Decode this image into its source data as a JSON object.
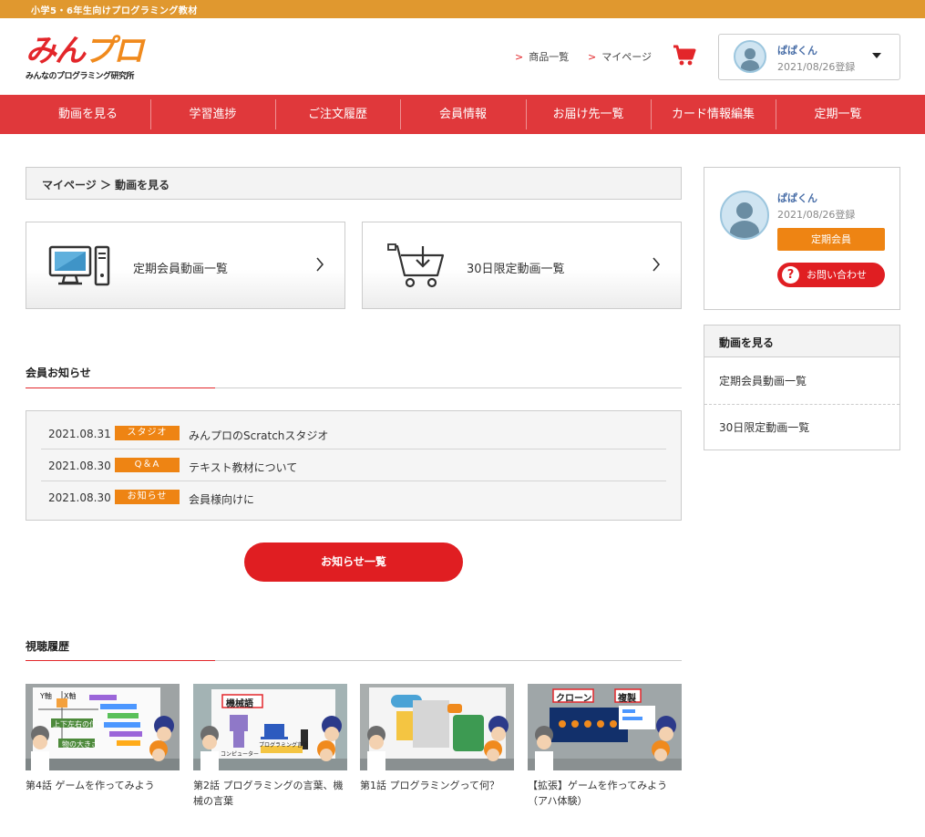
{
  "topbar": {
    "text": "小学5・6年生向けプログラミング教材"
  },
  "logo": {
    "main_a": "みん",
    "main_b": "プロ",
    "sub": "みんなのプログラミング研究所"
  },
  "header": {
    "links": [
      {
        "label": "商品一覧"
      },
      {
        "label": "マイページ"
      }
    ],
    "cart_icon": "cart-icon"
  },
  "user": {
    "name": "ぱぱくん",
    "registered": "2021/08/26登録",
    "plan": "定期会員",
    "contact": "お問い合わせ"
  },
  "nav": {
    "items": [
      "動画を見る",
      "学習進捗",
      "ご注文履歴",
      "会員情報",
      "お届け先一覧",
      "カード情報編集",
      "定期一覧"
    ]
  },
  "breadcrumb": {
    "text": "マイページ ＞ 動画を見る"
  },
  "cards": [
    {
      "label": "定期会員動画一覧",
      "icon": "computer-icon"
    },
    {
      "label": "30日限定動画一覧",
      "icon": "cart-download-icon"
    }
  ],
  "news": {
    "heading": "会員お知らせ",
    "items": [
      {
        "date": "2021.08.31",
        "tag": "スタジオ",
        "title": "みんプロのScratchスタジオ"
      },
      {
        "date": "2021.08.30",
        "tag": "Q＆A",
        "title": "テキスト教材について"
      },
      {
        "date": "2021.08.30",
        "tag": "お知らせ",
        "title": "会員様向けに"
      }
    ],
    "more_label": "お知らせ一覧"
  },
  "history": {
    "heading": "視聴履歴",
    "items": [
      {
        "title": "第4話 ゲームを作ってみよう",
        "labels": [
          "Y軸",
          "X軸",
          "上下左右の位置",
          "物の大きさ"
        ]
      },
      {
        "title": "第2話 プログラミングの言葉、機械の言葉",
        "labels": [
          "機械語",
          "コンピューター",
          "プログラミング言語"
        ]
      },
      {
        "title": "第1話 プログラミングって何？",
        "labels": []
      },
      {
        "title": "【拡張】ゲームを作ってみよう（アハ体験）",
        "labels": [
          "クローン",
          "複製"
        ]
      }
    ]
  },
  "sidebar_menu": {
    "heading": "動画を見る",
    "items": [
      "定期会員動画一覧",
      "30日限定動画一覧"
    ]
  },
  "colors": {
    "orange": "#e0982f",
    "red": "#e0383b",
    "badge": "#ee8413",
    "button_red": "#e01e22"
  }
}
